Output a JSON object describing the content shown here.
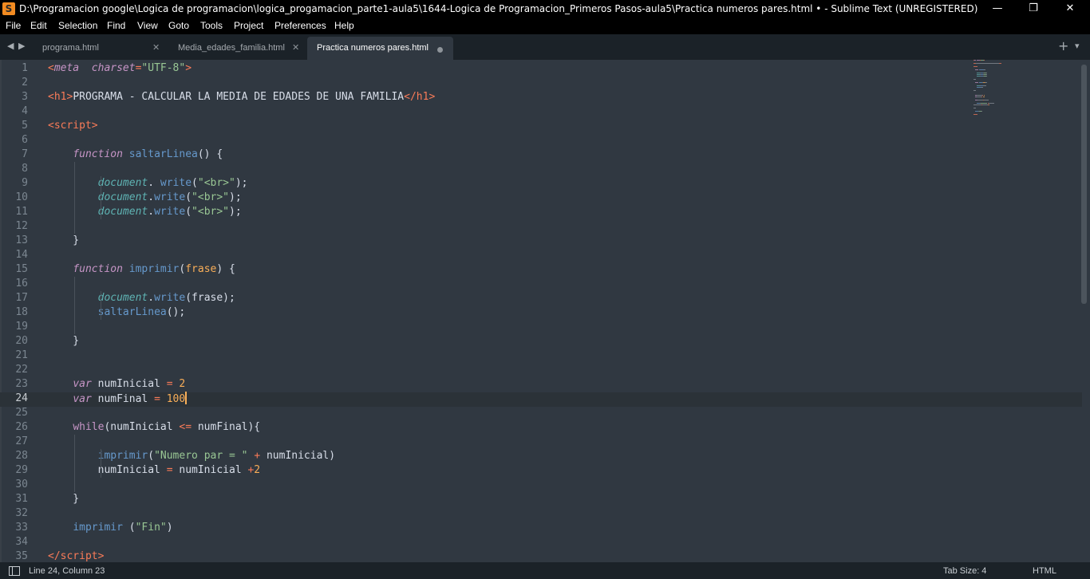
{
  "window": {
    "title": "D:\\Programacion google\\Logica de programacion\\logica_progamacion_parte1-aula5\\1644-Logica de Programacion_Primeros Pasos-aula5\\Practica numeros pares.html • - Sublime Text (UNREGISTERED)",
    "app_icon_letter": "S",
    "minimize": "—",
    "restore": "❐",
    "close": "✕"
  },
  "menu": [
    "File",
    "Edit",
    "Selection",
    "Find",
    "View",
    "Goto",
    "Tools",
    "Project",
    "Preferences",
    "Help"
  ],
  "tabs": [
    {
      "label": "programa.html",
      "close": "✕",
      "active": false
    },
    {
      "label": "Media_edades_familia.html",
      "close": "✕",
      "active": false
    },
    {
      "label": "Practica numeros pares.html",
      "dirty": true,
      "active": true
    }
  ],
  "tabbar_icons": {
    "left": "◀",
    "right": "▶",
    "add": "+",
    "more": "▾"
  },
  "editor": {
    "current_line": 24,
    "lines": [
      [
        [
          "tag",
          "<"
        ],
        [
          "attr",
          "meta"
        ],
        [
          "",
          "  "
        ],
        [
          "attr",
          "charset"
        ],
        [
          "op",
          "="
        ],
        [
          "str",
          "\"UTF-8\""
        ],
        [
          "tag",
          ">"
        ]
      ],
      [],
      [
        [
          "tag",
          "<"
        ],
        [
          "tag",
          "h1"
        ],
        [
          "tag",
          ">"
        ],
        [
          "",
          "PROGRAMA - CALCULAR LA MEDIA DE EDADES DE UNA FAMILIA"
        ],
        [
          "tag",
          "</"
        ],
        [
          "tag",
          "h1"
        ],
        [
          "tag",
          ">"
        ]
      ],
      [],
      [
        [
          "tag",
          "<"
        ],
        [
          "tag",
          "script"
        ],
        [
          "tag",
          ">"
        ]
      ],
      [],
      [
        [
          "",
          "    "
        ],
        [
          "kw",
          "function"
        ],
        [
          "",
          " "
        ],
        [
          "fn",
          "saltarLinea"
        ],
        [
          "",
          "() {"
        ]
      ],
      [],
      [
        [
          "",
          "        "
        ],
        [
          "sup",
          "document"
        ],
        [
          "",
          ". "
        ],
        [
          "fn",
          "write"
        ],
        [
          "",
          "("
        ],
        [
          "str",
          "\"<br>\""
        ],
        [
          "",
          ");"
        ]
      ],
      [
        [
          "",
          "        "
        ],
        [
          "sup",
          "document"
        ],
        [
          "",
          "."
        ],
        [
          "fn",
          "write"
        ],
        [
          "",
          "("
        ],
        [
          "str",
          "\"<br>\""
        ],
        [
          "",
          ");"
        ]
      ],
      [
        [
          "",
          "        "
        ],
        [
          "sup",
          "document"
        ],
        [
          "",
          "."
        ],
        [
          "fn",
          "write"
        ],
        [
          "",
          "("
        ],
        [
          "str",
          "\"<br>\""
        ],
        [
          "",
          ");"
        ]
      ],
      [],
      [
        [
          "",
          "    }"
        ]
      ],
      [],
      [
        [
          "",
          "    "
        ],
        [
          "kw",
          "function"
        ],
        [
          "",
          " "
        ],
        [
          "fn",
          "imprimir"
        ],
        [
          "",
          "("
        ],
        [
          "param",
          "frase"
        ],
        [
          "",
          ") {"
        ]
      ],
      [],
      [
        [
          "",
          "        "
        ],
        [
          "sup",
          "document"
        ],
        [
          "",
          "."
        ],
        [
          "fn",
          "write"
        ],
        [
          "",
          "(frase);"
        ]
      ],
      [
        [
          "",
          "        "
        ],
        [
          "fn",
          "saltarLinea"
        ],
        [
          "",
          "();"
        ]
      ],
      [],
      [
        [
          "",
          "    }"
        ]
      ],
      [],
      [],
      [
        [
          "",
          "    "
        ],
        [
          "kw",
          "var"
        ],
        [
          "",
          " numInicial "
        ],
        [
          "op",
          "="
        ],
        [
          "",
          " "
        ],
        [
          "num",
          "2"
        ]
      ],
      [
        [
          "",
          "    "
        ],
        [
          "kw",
          "var"
        ],
        [
          "",
          " numFinal "
        ],
        [
          "op",
          "="
        ],
        [
          "",
          " "
        ],
        [
          "num",
          "100"
        ]
      ],
      [],
      [
        [
          "",
          "    "
        ],
        [
          "kwp",
          "while"
        ],
        [
          "",
          "(numInicial "
        ],
        [
          "op",
          "<="
        ],
        [
          "",
          " numFinal){"
        ]
      ],
      [],
      [
        [
          "",
          "        "
        ],
        [
          "fn",
          "imprimir"
        ],
        [
          "",
          "("
        ],
        [
          "str",
          "\"Numero par = \""
        ],
        [
          "",
          " "
        ],
        [
          "op",
          "+"
        ],
        [
          "",
          " numInicial)"
        ]
      ],
      [
        [
          "",
          "        numInicial "
        ],
        [
          "op",
          "="
        ],
        [
          "",
          " numInicial "
        ],
        [
          "op",
          "+"
        ],
        [
          "num",
          "2"
        ]
      ],
      [],
      [
        [
          "",
          "    }"
        ]
      ],
      [],
      [
        [
          "",
          "    "
        ],
        [
          "fn",
          "imprimir"
        ],
        [
          "",
          " ("
        ],
        [
          "str",
          "\"Fin\""
        ],
        [
          "",
          ")"
        ]
      ],
      [],
      [
        [
          "tag",
          "</"
        ],
        [
          "tag",
          "script"
        ],
        [
          "tag",
          ">"
        ]
      ]
    ]
  },
  "status": {
    "position": "Line 24, Column 23",
    "tab_size": "Tab Size: 4",
    "syntax": "HTML"
  }
}
